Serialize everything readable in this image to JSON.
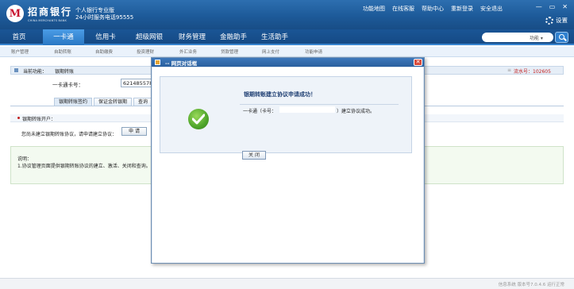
{
  "header": {
    "logo_glyph": "M",
    "bank_name": "招商银行",
    "bank_name_en": "CHINA MERCHANTS BANK",
    "slogan_line1": "个人银行专业版",
    "slogan_line2": "24小时服务电话95555",
    "links": [
      "功能地图",
      "在线客服",
      "帮助中心",
      "重新登录",
      "安全退出"
    ],
    "window_controls": [
      "—",
      "▭",
      "✕"
    ],
    "settings_label": "设置"
  },
  "nav": {
    "items": [
      "首页",
      "一卡通",
      "信用卡",
      "超级网银",
      "财务管理",
      "金融助手",
      "生活助手"
    ],
    "active": "一卡通",
    "search_scope": "功能 ▾"
  },
  "subnav": {
    "items": [
      "账户管理",
      "自助转账",
      "自助缴费",
      "投资理财",
      "外汇业务",
      "贷款管理",
      "网上支付",
      "功能申请"
    ]
  },
  "content": {
    "func_label": "当前功能：",
    "func_value": "银期转账",
    "flow_label": "流水号：102605",
    "card_label": "一卡通卡号：",
    "card_value": "621485578",
    "tabs": [
      "银期转账签约",
      "保证金转银期",
      "查询"
    ],
    "sign_label": "银期转账开户：",
    "apply_text": "您尚未建立银期转账协议，请申请建立协议：",
    "apply_button": "申 请",
    "note_title": "说明：",
    "note_text": "1.协议管理页面提供银期转账协议的建立、激活、关闭和查询。"
  },
  "dialog": {
    "title": "-- 网页对话框",
    "close_glyph": "✕",
    "result_title": "银期转账建立协议申请成功！",
    "card_label": "一卡通（卡号：",
    "card_value": "",
    "result_msg": "）建立协议成功。",
    "close_button": "关 闭"
  },
  "status": {
    "text": "信息系统    版本号7.0.4.6 运行正常"
  },
  "colors": {
    "header_blue": "#1d5a99",
    "accent_red": "#c21f1f",
    "success_green": "#4ea52a"
  }
}
